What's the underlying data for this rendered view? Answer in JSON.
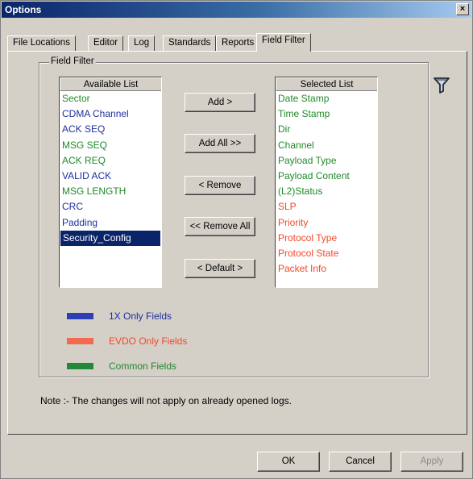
{
  "window": {
    "title": "Options",
    "close_label": "×"
  },
  "tabs": [
    {
      "label": "File Locations",
      "active": false
    },
    {
      "label": "Editor",
      "active": false
    },
    {
      "label": "Log",
      "active": false
    },
    {
      "label": "Standards",
      "active": false
    },
    {
      "label": "Reports",
      "active": false
    },
    {
      "label": "Field Filter",
      "active": true
    }
  ],
  "field_filter": {
    "group_label": "Field Filter",
    "icon": "filter-funnel-icon",
    "available_list": {
      "header": "Available List",
      "items": [
        {
          "label": "Sector",
          "type": "common"
        },
        {
          "label": "CDMA Channel",
          "type": "1x"
        },
        {
          "label": "ACK SEQ",
          "type": "1x"
        },
        {
          "label": "MSG SEQ",
          "type": "common"
        },
        {
          "label": "ACK REQ",
          "type": "common"
        },
        {
          "label": "VALID ACK",
          "type": "1x"
        },
        {
          "label": "MSG LENGTH",
          "type": "common"
        },
        {
          "label": "CRC",
          "type": "1x"
        },
        {
          "label": "Padding",
          "type": "1x"
        },
        {
          "label": "Security_Config",
          "type": "1x",
          "selected": true
        }
      ]
    },
    "selected_list": {
      "header": "Selected List",
      "items": [
        {
          "label": "Date Stamp",
          "type": "common"
        },
        {
          "label": "Time Stamp",
          "type": "common"
        },
        {
          "label": "Dir",
          "type": "common"
        },
        {
          "label": "Channel",
          "type": "common"
        },
        {
          "label": "Payload Type",
          "type": "common"
        },
        {
          "label": "Payload Content",
          "type": "common"
        },
        {
          "label": "(L2)Status",
          "type": "common"
        },
        {
          "label": "SLP",
          "type": "evdo"
        },
        {
          "label": "Priority",
          "type": "evdo"
        },
        {
          "label": "Protocol Type",
          "type": "evdo"
        },
        {
          "label": "Protocol State",
          "type": "evdo"
        },
        {
          "label": "Packet Info",
          "type": "evdo"
        }
      ]
    },
    "buttons": {
      "add": "Add >",
      "add_all": "Add All >>",
      "remove": "< Remove",
      "remove_all": "<< Remove All",
      "default": "< Default >"
    },
    "legend": [
      {
        "label": "1X Only Fields",
        "color": "#2d3fb5"
      },
      {
        "label": "EVDO Only Fields",
        "color": "#f36a4c"
      },
      {
        "label": "Common Fields",
        "color": "#23883a"
      }
    ]
  },
  "note": "Note :- The changes will not apply on already opened logs.",
  "footer": {
    "ok": "OK",
    "cancel": "Cancel",
    "apply": "Apply"
  },
  "colors": {
    "1x": "#1e2fa0",
    "evdo": "#f04a2a",
    "common": "#1f8a2a",
    "selection": "#0a246a"
  }
}
